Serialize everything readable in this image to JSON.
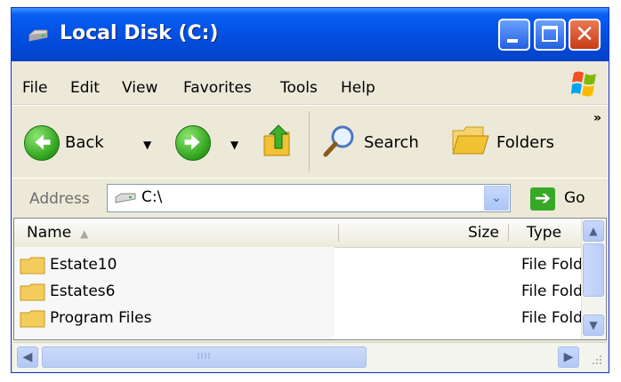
{
  "window": {
    "title": "Local Disk (C:)",
    "close_glyph": "✕"
  },
  "menu": {
    "items": [
      "File",
      "Edit",
      "View",
      "Favorites",
      "Tools",
      "Help"
    ]
  },
  "toolbar": {
    "back_label": "Back",
    "search_label": "Search",
    "folders_label": "Folders",
    "dropdown_glyph": "▼",
    "overflow_glyph": "»"
  },
  "address": {
    "label": "Address",
    "value": "C:\\",
    "dropdown_glyph": "⌄",
    "go_glyph": "➔",
    "go_label": "Go"
  },
  "list": {
    "columns": {
      "name": "Name",
      "size": "Size",
      "type": "Type",
      "sort_glyph": "▲"
    },
    "rows": [
      {
        "name": "Estate10",
        "type": "File Fold"
      },
      {
        "name": "Estates6",
        "type": "File Fold"
      },
      {
        "name": "Program Files",
        "type": "File Fold"
      }
    ]
  },
  "scrollbar": {
    "up_glyph": "▲",
    "down_glyph": "▼",
    "left_glyph": "◀",
    "right_glyph": "▶",
    "thumb_grip": "IIII"
  },
  "colors": {
    "titlebar": "#0453e8",
    "window_bg": "#ece9d8",
    "close_button": "#c83a14",
    "go_button": "#38a828"
  }
}
